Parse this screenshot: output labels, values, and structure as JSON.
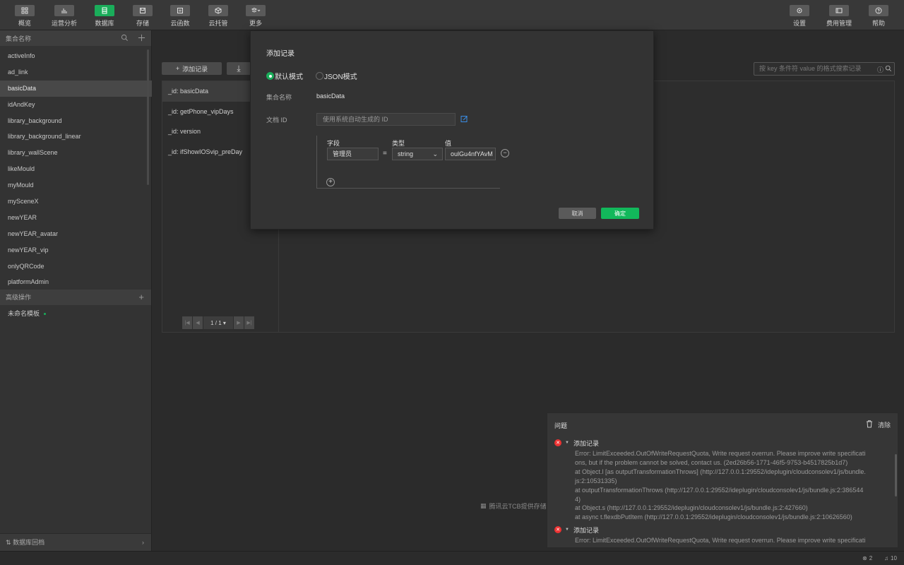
{
  "toolbar": {
    "left": [
      {
        "label": "概览",
        "icon": "overview-icon"
      },
      {
        "label": "运营分析",
        "icon": "analytics-icon"
      },
      {
        "label": "数据库",
        "icon": "database-icon",
        "active": true
      },
      {
        "label": "存储",
        "icon": "storage-icon"
      },
      {
        "label": "云函数",
        "icon": "cloud-function-icon"
      },
      {
        "label": "云托管",
        "icon": "cloud-hosting-icon"
      },
      {
        "label": "更多",
        "icon": "more-icon"
      }
    ],
    "right": [
      {
        "label": "设置",
        "icon": "settings-icon"
      },
      {
        "label": "费用管理",
        "icon": "billing-icon"
      },
      {
        "label": "帮助",
        "icon": "help-icon"
      }
    ],
    "active_color": "#1aad5a"
  },
  "sidebar": {
    "collections_header": "集合名称",
    "collections": [
      "activeInfo",
      "ad_link",
      "basicData",
      "idAndKey",
      "library_background",
      "library_background_linear",
      "library_wallScene",
      "likeMould",
      "myMould",
      "mySceneX",
      "newYEAR",
      "newYEAR_avatar",
      "newYEAR_vip",
      "onlyQRCode",
      "platformAdmin"
    ],
    "selected_collection": "basicData",
    "advanced_header": "高级操作",
    "template_name": "未命名模板",
    "footer_label": "数据库回档"
  },
  "main": {
    "add_record_label": "添加记录",
    "search_placeholder": "按 key 条件符 value 的格式搜索记录",
    "documents": [
      "_id: basicData",
      "_id: getPhone_vipDays",
      "_id: version",
      "_id: ifShowIOSvip_preDay"
    ],
    "pager": "1 / 1",
    "footer_note": "腾讯云TCB提供存储..."
  },
  "modal": {
    "title": "添加记录",
    "mode_default": "默认模式",
    "mode_json": "JSON模式",
    "collection_label": "集合名称",
    "collection_value": "basicData",
    "doc_id_label": "文档 ID",
    "doc_id_placeholder": "使用系统自动生成的 ID",
    "field_col": "字段",
    "type_col": "类型",
    "value_col": "值",
    "field_value": "管理员",
    "type_value": "string",
    "value_value": "oulGu4nfYAvM",
    "equals": "=",
    "cancel": "取消",
    "ok": "确定",
    "ok_color": "#12b85b"
  },
  "problems": {
    "title": "问题",
    "clear": "清除",
    "entries": [
      {
        "title": "添加记录",
        "lines": [
          "Error: LimitExceeded.OutOfWriteRequestQuota, Write request overrun. Please improve write specificati",
          "ons, but if the problem cannot be solved, contact us. (2ed26b56-1771-46f5-9753-b4517825b1d7)",
          "at Object.l [as outputTransformationThrows] (http://127.0.0.1:29552/ideplugin/cloudconsolev1/js/bundle.",
          "js:2:10531335)",
          "at outputTransformationThrows (http://127.0.0.1:29552/ideplugin/cloudconsolev1/js/bundle.js:2:386544",
          "4)",
          "at Object.s (http://127.0.0.1:29552/ideplugin/cloudconsolev1/js/bundle.js:2:427660)",
          "at async t.flexdbPutItem (http://127.0.0.1:29552/ideplugin/cloudconsolev1/js/bundle.js:2:10626560)"
        ]
      },
      {
        "title": "添加记录",
        "lines": [
          "Error: LimitExceeded.OutOfWriteRequestQuota, Write request overrun. Please improve write specificati"
        ]
      }
    ],
    "error_color": "#e33333"
  },
  "statusbar": {
    "errors": "2",
    "notifications": "10"
  }
}
